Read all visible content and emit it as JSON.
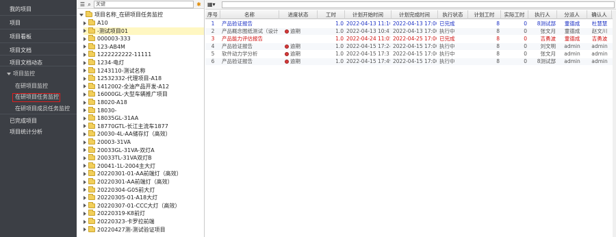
{
  "nav": {
    "items": [
      {
        "label": "我的项目",
        "level": "top"
      },
      {
        "label": "项目",
        "level": "top"
      },
      {
        "label": "项目看板",
        "level": "top"
      },
      {
        "label": "项目文档",
        "level": "top"
      },
      {
        "label": "项目文档动态",
        "level": "top"
      },
      {
        "label": "项目监控",
        "level": "group"
      },
      {
        "label": "在研项目监控",
        "level": "sub"
      },
      {
        "label": "在研项目任务监控",
        "level": "sub",
        "active": true
      },
      {
        "label": "在研项目成员任务监控",
        "level": "sub"
      },
      {
        "label": "已完成项目",
        "level": "top"
      },
      {
        "label": "项目统计分析",
        "level": "top"
      }
    ],
    "highlight_color": "#e02020"
  },
  "tree": {
    "search_placeholder": "关键",
    "root_label": "项目名称_在研项目任务监控",
    "nodes": [
      "A10",
      "-测试项目01",
      "000003-333",
      "123-AB4M",
      "1222222222-11111",
      "1234-电灯",
      "1243110-测试名称",
      "12532332-代理项目-A18",
      "1412002-全油产品开发-A12",
      "16000GL-大型车辆推广项目",
      "18020-A18",
      "18030-",
      "18035GL-31AA",
      "18770GTL-长江主流车1877",
      "20030-4L-AA储存灯（高效）",
      "20003-31VA",
      "20033GL-31VA-双灯A",
      "20033TL-31VA双灯B",
      "20041-1L-2004主大灯",
      "20220301-01-AA前端灯（高效）",
      "20220301-AA前端灯（高效）",
      "20220304-G05前大灯",
      "20220305-01-A18大灯",
      "20220307-01-CCC大灯（高效）",
      "20220319-K8前灯",
      "20220323-卡罗拉前端",
      "20220427测-测试验证项目"
    ]
  },
  "grid": {
    "columns": [
      "序号",
      "名称",
      "进度状态",
      "工时",
      "计划开始时间",
      "计划完成时间",
      "执行状态",
      "计划工时",
      "实际工时",
      "执行人",
      "分派人",
      "确认人"
    ],
    "rows": [
      {
        "no": "1",
        "name": "产品验证报告",
        "progress": "",
        "hours": "1.0",
        "start": "2022-04-13 11:10",
        "end": "2022-04-13 17:00",
        "state": "已完成",
        "plan_h": "8",
        "actual_h": "0",
        "executor": "8测试部",
        "assigner": "童德成",
        "confirmer": "杜慧慧",
        "color": "blue"
      },
      {
        "no": "2",
        "name": "产品概念图纸测试（设计）",
        "progress": "逾期",
        "hours": "1.0",
        "start": "2022-04-13 10:41",
        "end": "2022-04-13 17:00",
        "state": "执行中",
        "plan_h": "8",
        "actual_h": "0",
        "executor": "张文月",
        "assigner": "童德成",
        "confirmer": "赵文川",
        "color": "gray"
      },
      {
        "no": "3",
        "name": "产品能力评估报告",
        "progress": "",
        "hours": "1.0",
        "start": "2022-04-24 11:05",
        "end": "2022-04-25 17:00",
        "state": "已完成",
        "plan_h": "8",
        "actual_h": "0",
        "executor": "吉勇波",
        "assigner": "童德成",
        "confirmer": "吉勇波",
        "color": "red"
      },
      {
        "no": "4",
        "name": "产品验证报告",
        "progress": "逾期",
        "hours": "1.0",
        "start": "2022-04-15 17:24",
        "end": "2022-04-15 17:00",
        "state": "执行中",
        "plan_h": "8",
        "actual_h": "0",
        "executor": "刘文明",
        "assigner": "admin",
        "confirmer": "admin",
        "color": "gray"
      },
      {
        "no": "5",
        "name": "软件动力学分析",
        "progress": "逾期",
        "hours": "1.0",
        "start": "2022-04-15 17:31",
        "end": "2022-04-15 17:00",
        "state": "执行中",
        "plan_h": "8",
        "actual_h": "0",
        "executor": "张文月",
        "assigner": "admin",
        "confirmer": "admin",
        "color": "gray"
      },
      {
        "no": "6",
        "name": "产品验证报告",
        "progress": "逾期",
        "hours": "1.0",
        "start": "2022-04-15 17:49",
        "end": "2022-04-15 17:00",
        "state": "执行中",
        "plan_h": "8",
        "actual_h": "0",
        "executor": "8测试部",
        "assigner": "admin",
        "confirmer": "admin",
        "color": "gray"
      }
    ]
  }
}
